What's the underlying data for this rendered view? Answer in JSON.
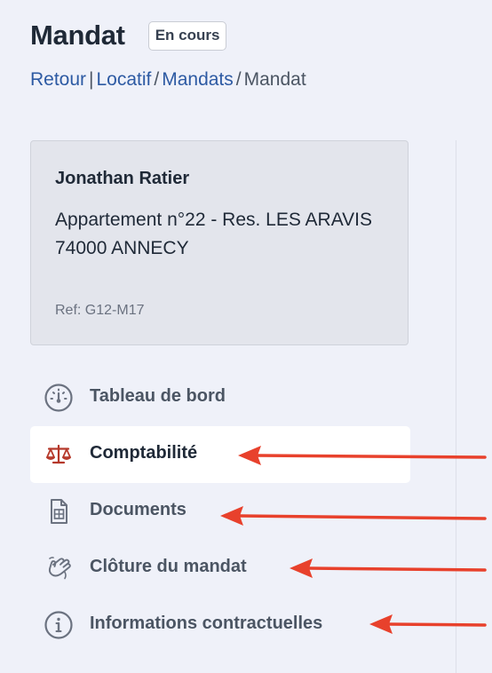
{
  "header": {
    "title": "Mandat",
    "status_badge": "En cours"
  },
  "breadcrumb": {
    "back": "Retour",
    "separator": "|",
    "items": [
      "Locatif",
      "Mandats",
      "Mandat"
    ],
    "slash": "/"
  },
  "card": {
    "name": "Jonathan Ratier",
    "address_line1": "Appartement n°22 - Res. LES ARAVIS",
    "address_line2": "74000 ANNECY",
    "ref": "Ref: G12-M17"
  },
  "nav": {
    "items": [
      {
        "label": "Tableau de bord",
        "icon": "gauge-icon",
        "active": false
      },
      {
        "label": "Comptabilité",
        "icon": "scale-icon",
        "active": true
      },
      {
        "label": "Documents",
        "icon": "document-table-icon",
        "active": false
      },
      {
        "label": "Clôture du mandat",
        "icon": "waving-hand-icon",
        "active": false
      },
      {
        "label": "Informations contractuelles",
        "icon": "info-circle-icon",
        "active": false
      }
    ]
  },
  "colors": {
    "background": "#eff1f9",
    "link": "#2d5aa3",
    "active_icon": "#b5382a",
    "annotation_arrow": "#e8412c"
  }
}
